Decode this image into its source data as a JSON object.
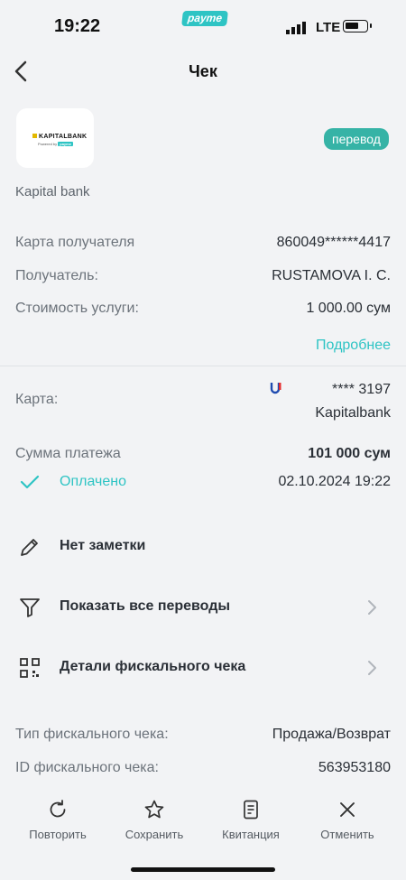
{
  "status_bar": {
    "time": "19:22",
    "brand": "payme",
    "network": "LTE"
  },
  "header": {
    "title": "Чек"
  },
  "merchant": {
    "logo_text": "KAPITALBANK",
    "logo_subtitle": "Powered by",
    "logo_subtitle_brand": "payme",
    "name": "Kapital bank",
    "tag": "перевод"
  },
  "details": [
    {
      "label": "Карта получателя",
      "value": "860049******4417"
    },
    {
      "label": "Получатель:",
      "value": "RUSTAMOVA I. C."
    },
    {
      "label": "Стоимость услуги:",
      "value": "1 000.00 сум"
    }
  ],
  "more_link": "Подробнее",
  "card": {
    "label": "Карта:",
    "number": "**** 3197",
    "bank": "Kapitalbank"
  },
  "payment": {
    "label": "Сумма платежа",
    "amount": "101 000 сум"
  },
  "status": {
    "label": "Оплачено",
    "datetime": "02.10.2024 19:22"
  },
  "actions": [
    {
      "label": "Нет заметки",
      "icon": "pencil-icon"
    },
    {
      "label": "Показать все переводы",
      "icon": "filter-icon"
    },
    {
      "label": "Детали фискального чека",
      "icon": "qr-code-icon"
    }
  ],
  "fiscal": [
    {
      "label": "Тип фискального чека:",
      "value": "Продажа/Возврат"
    },
    {
      "label": "ID фискального чека:",
      "value": "563953180"
    }
  ],
  "bottom_bar": [
    {
      "label": "Повторить",
      "icon": "refresh-icon"
    },
    {
      "label": "Сохранить",
      "icon": "star-icon"
    },
    {
      "label": "Квитанция",
      "icon": "receipt-icon"
    },
    {
      "label": "Отменить",
      "icon": "close-icon"
    }
  ],
  "colors": {
    "accent": "#2ec4c4",
    "tag": "#36b3a6",
    "background": "#f2f3f5"
  }
}
